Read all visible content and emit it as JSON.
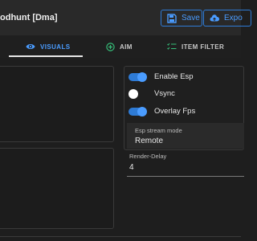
{
  "window": {
    "title": "odhunt [Dma]"
  },
  "toolbar": {
    "save_label": "Save",
    "export_label": "Expo"
  },
  "tabs": [
    {
      "label": "VISUALS",
      "icon": "eye-icon",
      "active": true
    },
    {
      "label": "AIM",
      "icon": "plus-circle-icon",
      "active": false
    },
    {
      "label": "ITEM FILTER",
      "icon": "checklist-icon",
      "active": false
    }
  ],
  "settings": {
    "enable_esp": {
      "label": "Enable Esp",
      "on": true
    },
    "vsync": {
      "label": "Vsync",
      "on": false
    },
    "overlay_fps": {
      "label": "Overlay Fps",
      "on": true
    },
    "esp_stream_mode": {
      "label": "Esp stream mode",
      "value": "Remote"
    },
    "render_delay": {
      "label": "Render-Delay",
      "value": "4"
    }
  },
  "colors": {
    "accent": "#4a9cff",
    "background": "#1e1e1e",
    "panel_border": "#3a3a3a"
  }
}
